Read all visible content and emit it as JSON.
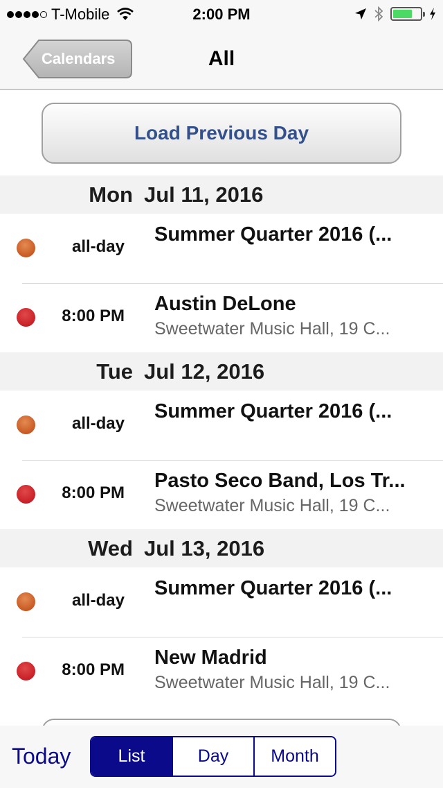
{
  "status_bar": {
    "signal_bars_filled": 4,
    "signal_bars_total": 5,
    "carrier": "T-Mobile",
    "time": "2:00 PM",
    "battery_percent": 70,
    "charging": true
  },
  "nav": {
    "back_label": "Calendars",
    "title": "All"
  },
  "load_previous_label": "Load Previous Day",
  "days": [
    {
      "dow": "Mon",
      "date": "Jul 11, 2016",
      "events": [
        {
          "time": "all-day",
          "title": "Summer Quarter 2016 (...",
          "subtitle": "",
          "color": "orange"
        },
        {
          "time": "8:00 PM",
          "title": "Austin DeLone",
          "subtitle": "Sweetwater Music Hall, 19 C...",
          "color": "red"
        }
      ]
    },
    {
      "dow": "Tue",
      "date": "Jul 12, 2016",
      "events": [
        {
          "time": "all-day",
          "title": "Summer Quarter 2016 (...",
          "subtitle": "",
          "color": "orange"
        },
        {
          "time": "8:00 PM",
          "title": "Pasto Seco Band, Los Tr...",
          "subtitle": "Sweetwater Music Hall, 19 C...",
          "color": "red"
        }
      ]
    },
    {
      "dow": "Wed",
      "date": "Jul 13, 2016",
      "events": [
        {
          "time": "all-day",
          "title": "Summer Quarter 2016 (...",
          "subtitle": "",
          "color": "orange"
        },
        {
          "time": "8:00 PM",
          "title": "New Madrid",
          "subtitle": "Sweetwater Music Hall, 19 C...",
          "color": "red"
        }
      ]
    }
  ],
  "colors": {
    "calendar_orange": "#c85a24",
    "calendar_red": "#c82028",
    "accent": "#0a0a8a",
    "load_button_text": "#34508a"
  },
  "toolbar": {
    "today_label": "Today",
    "segments": [
      {
        "label": "List",
        "active": true
      },
      {
        "label": "Day",
        "active": false
      },
      {
        "label": "Month",
        "active": false
      }
    ]
  }
}
